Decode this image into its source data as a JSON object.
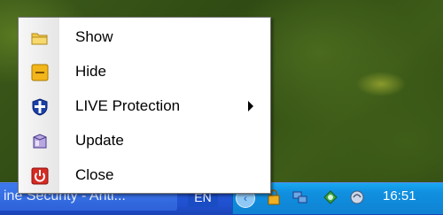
{
  "context_menu": {
    "items": [
      {
        "label": "Show",
        "icon": "folder-icon",
        "has_submenu": false
      },
      {
        "label": "Hide",
        "icon": "minimize-window-icon",
        "has_submenu": false
      },
      {
        "label": "LIVE Protection",
        "icon": "shield-icon",
        "has_submenu": true
      },
      {
        "label": "Update",
        "icon": "update-box-icon",
        "has_submenu": false
      },
      {
        "label": "Close",
        "icon": "power-icon",
        "has_submenu": false
      }
    ]
  },
  "taskbar": {
    "button_text": "ine Security - Anti...",
    "language": "EN",
    "clock": "16:51"
  },
  "colors": {
    "taskbar_blue": "#2457d6",
    "tray_blue": "#0f82d2",
    "close_red": "#d62a22",
    "hide_yellow": "#f2b51a",
    "folder_yellow": "#f3c84a"
  }
}
